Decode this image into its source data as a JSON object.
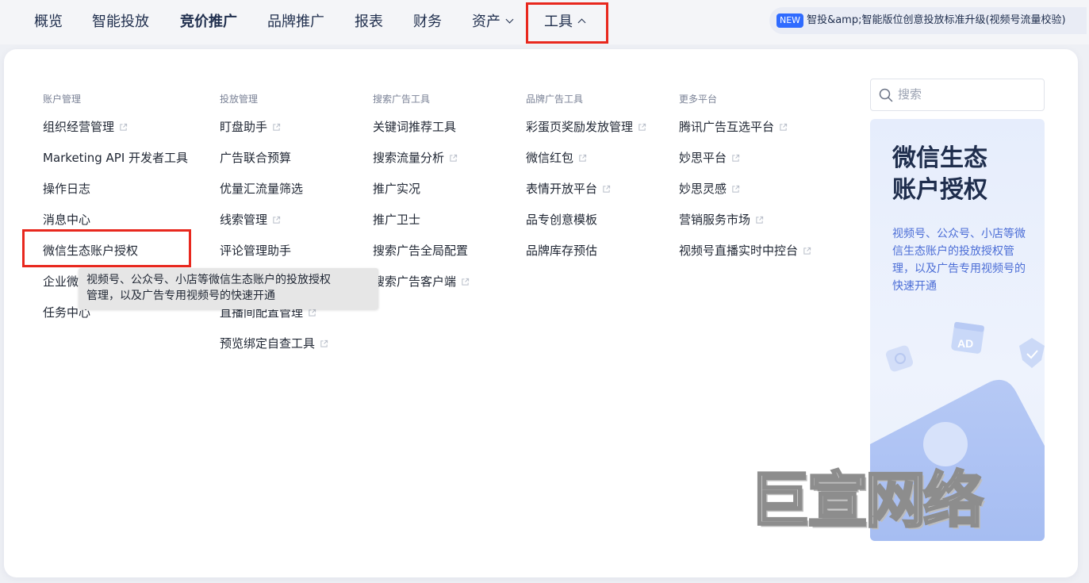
{
  "nav": {
    "items": [
      "概览",
      "智能投放",
      "竞价推广",
      "品牌推广",
      "报表",
      "财务",
      "资产",
      "工具"
    ],
    "notice_badge": "NEW",
    "notice_text": "智投&amp;智能版位创意投放标准升级(视频号流量校验)"
  },
  "columns": [
    {
      "title": "账户管理",
      "items": [
        "组织经营管理",
        "Marketing API 开发者工具",
        "操作日志",
        "消息中心",
        "微信生态账户授权",
        "企业微",
        "任务中心"
      ]
    },
    {
      "title": "投放管理",
      "items": [
        "盯盘助手",
        "广告联合预算",
        "优量汇流量筛选",
        "线索管理",
        "评论管理助手",
        "",
        "直播间配置管理",
        "预览绑定自查工具"
      ]
    },
    {
      "title": "搜索广告工具",
      "items": [
        "关键词推荐工具",
        "搜索流量分析",
        "推广实况",
        "推广卫士",
        "搜索广告全局配置",
        "搜索广告客户端"
      ]
    },
    {
      "title": "品牌广告工具",
      "items": [
        "彩蛋页奖励发放管理",
        "微信红包",
        "表情开放平台",
        "品专创意模板",
        "品牌库存预估"
      ]
    },
    {
      "title": "更多平台",
      "items": [
        "腾讯广告互选平台",
        "妙思平台",
        "妙思灵感",
        "营销服务市场",
        "视频号直播实时中控台"
      ]
    }
  ],
  "tooltip": {
    "line1": "视频号、公众号、小店等微信生态账户的投放授权",
    "line2": "管理，以及广告专用视频号的快速开通"
  },
  "search": {
    "placeholder": "搜索"
  },
  "promo": {
    "title_line1": "微信生态",
    "title_line2": "账户授权",
    "description": "视频号、公众号、小店等微信生态账户的投放授权管理，以及广告专用视频号的快速开通",
    "art_label": "AD"
  },
  "watermark": "巨宣网络",
  "colors": {
    "highlight": "#e8281e",
    "accent": "#2f6bff",
    "promo_text": "#4c6ed6"
  }
}
